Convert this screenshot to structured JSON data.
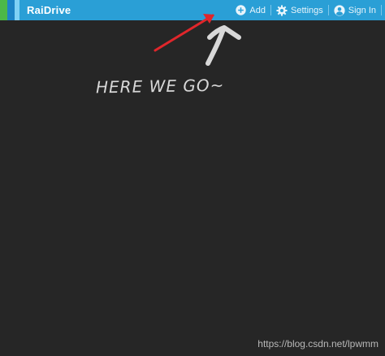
{
  "app": {
    "title": "RaiDrive"
  },
  "toolbar": {
    "add_label": "Add",
    "settings_label": "Settings",
    "signin_label": "Sign In"
  },
  "icons": {
    "add": "plus-circle-icon",
    "settings": "gear-icon",
    "signin": "user-circle-icon"
  },
  "colors": {
    "titlebar": "#2a9fd6",
    "content": "#262626",
    "arrow_red": "#e0262b"
  },
  "annotation": {
    "text": "HERE WE GO~"
  },
  "watermark": {
    "text": "https://blog.csdn.net/lpwmm"
  }
}
